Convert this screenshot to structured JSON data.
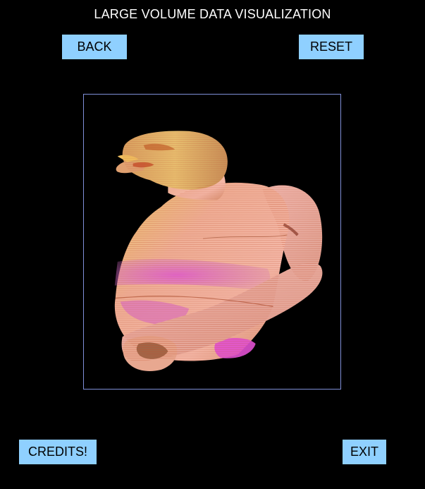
{
  "app": {
    "title": "LARGE VOLUME DATA VISUALIZATION"
  },
  "buttons": {
    "back_label": "BACK",
    "reset_label": "RESET",
    "credits_label": "CREDITS!",
    "exit_label": "EXIT"
  },
  "colors": {
    "background": "#000000",
    "button_fill": "#8fd0ff",
    "button_text": "#000000",
    "title_text": "#ffffff",
    "viewport_border": "#7f8fd8",
    "render_skin": "#f0b090",
    "render_highlight": "#e8d070",
    "render_magenta": "#d050c8",
    "render_shadow": "#b04a20"
  },
  "viewport": {
    "content": "volume-rendered human torso"
  }
}
